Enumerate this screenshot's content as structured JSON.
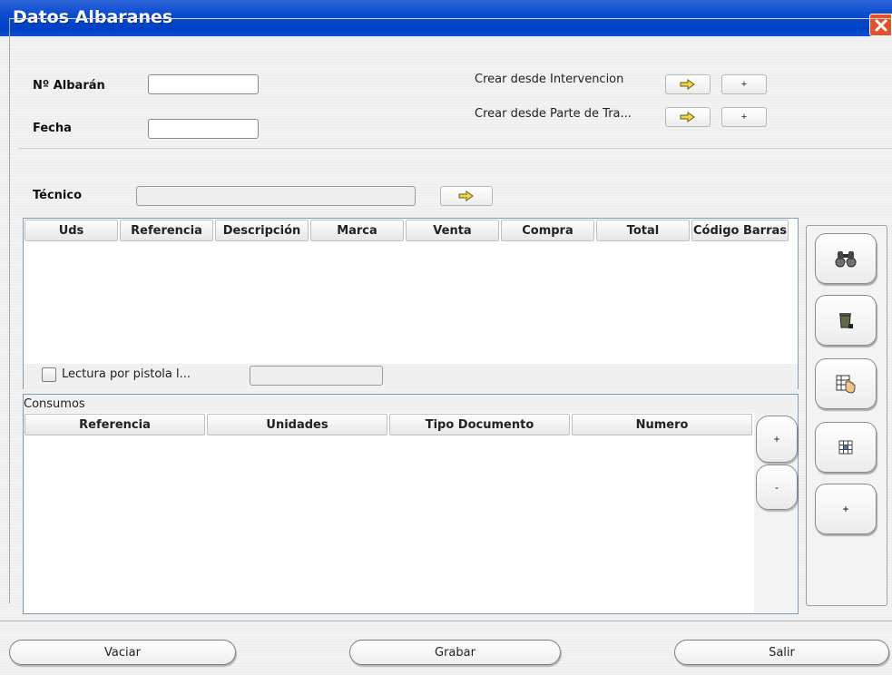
{
  "window": {
    "title": "Datos Albaranes"
  },
  "form": {
    "albaran_label": "Nº Albarán",
    "fecha_label": "Fecha",
    "tecnico_label": "Técnico",
    "crear_intervencion_label": "Crear desde Intervencion",
    "crear_parte_label": "Crear desde Parte de Tra...",
    "plus": "+"
  },
  "lines_table": {
    "columns": [
      "Uds",
      "Referencia",
      "Descripción",
      "Marca",
      "Venta",
      "Compra",
      "Total",
      "Código Barras"
    ]
  },
  "scanner": {
    "checkbox_label": "Lectura por pistola l..."
  },
  "consumos": {
    "title": "Consumos",
    "columns": [
      "Referencia",
      "Unidades",
      "Tipo Documento",
      "Numero"
    ],
    "add_label": "+",
    "remove_label": "-"
  },
  "side": {
    "plus": "+"
  },
  "footer": {
    "vaciar": "Vaciar",
    "grabar": "Grabar",
    "salir": "Salir"
  },
  "icons": [
    "arrow-icon",
    "binoculars-icon",
    "trash-icon",
    "select-hand-icon",
    "grid-icon",
    "close-icon"
  ]
}
